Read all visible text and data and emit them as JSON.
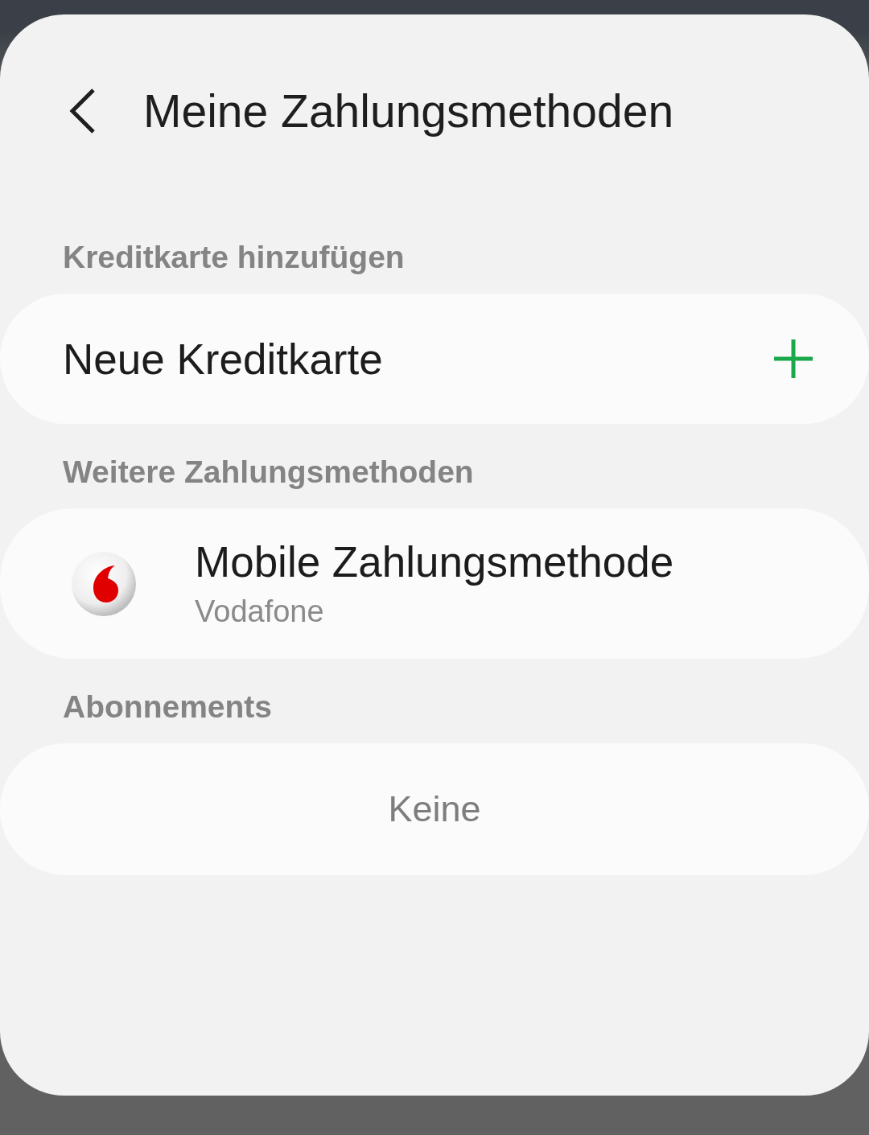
{
  "header": {
    "title": "Meine Zahlungsmethoden"
  },
  "sections": [
    {
      "label": "Kreditkarte hinzufügen",
      "items": [
        {
          "kind": "add",
          "title": "Neue Kreditkarte"
        }
      ]
    },
    {
      "label": "Weitere Zahlungsmethoden",
      "items": [
        {
          "kind": "method",
          "title": "Mobile Zahlungsmethode",
          "subtitle": "Vodafone"
        }
      ]
    },
    {
      "label": "Abonnements",
      "items": [
        {
          "kind": "empty",
          "title": "Keine"
        }
      ]
    }
  ]
}
